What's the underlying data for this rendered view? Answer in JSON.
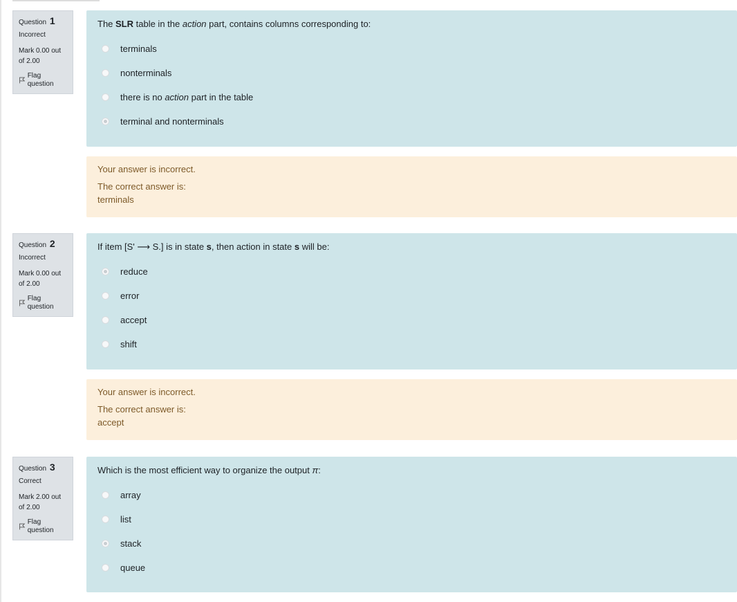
{
  "questions": [
    {
      "number": "1",
      "label": "Question",
      "state": "Incorrect",
      "grade": "Mark 0.00 out of 2.00",
      "flag": "Flag question",
      "text_parts": [
        "The ",
        "SLR",
        " table in the ",
        "action",
        " part, contains columns corresponding to:"
      ],
      "options": [
        {
          "text": "terminals",
          "checked": false
        },
        {
          "text": "nonterminals",
          "checked": false
        },
        {
          "text_parts": [
            "there is no ",
            "action",
            " part in the table"
          ],
          "checked": false
        },
        {
          "text": "terminal and nonterminals",
          "checked": true
        }
      ],
      "feedback": {
        "status": "Your answer is incorrect.",
        "correct_label": "The correct answer is:",
        "correct_value": "terminals"
      }
    },
    {
      "number": "2",
      "label": "Question",
      "state": "Incorrect",
      "grade": "Mark 0.00 out of 2.00",
      "flag": "Flag question",
      "text_parts": [
        "If item [S' ⟶ S.] is in state ",
        "s",
        ", then action in state ",
        "s",
        " will be:"
      ],
      "options": [
        {
          "text": "reduce",
          "checked": true
        },
        {
          "text": "error",
          "checked": false
        },
        {
          "text": "accept",
          "checked": false
        },
        {
          "text": "shift",
          "checked": false
        }
      ],
      "feedback": {
        "status": "Your answer is incorrect.",
        "correct_label": "The correct answer is:",
        "correct_value": "accept"
      }
    },
    {
      "number": "3",
      "label": "Question",
      "state": "Correct",
      "grade": "Mark 2.00 out of 2.00",
      "flag": "Flag question",
      "text_parts": [
        "Which is the most efficient way to organize the output ",
        "π",
        ":"
      ],
      "options": [
        {
          "text": "array",
          "checked": false
        },
        {
          "text": "list",
          "checked": false
        },
        {
          "text": "stack",
          "checked": true
        },
        {
          "text": "queue",
          "checked": false
        }
      ]
    }
  ]
}
